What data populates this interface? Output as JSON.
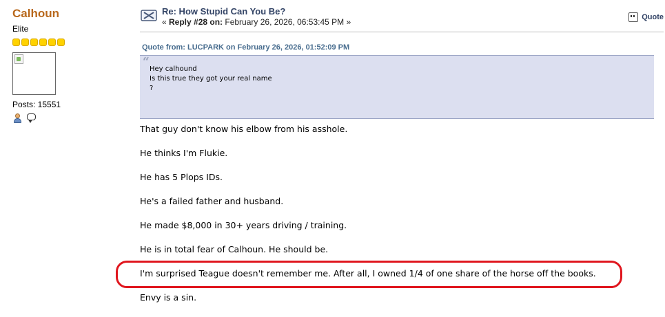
{
  "poster": {
    "name": "Calhoun",
    "rank": "Elite",
    "star_count": 6,
    "posts_label": "Posts: 15551"
  },
  "post": {
    "title": "Re: How Stupid Can You Be?",
    "meta_prefix": "« ",
    "reply_label": "Reply #28 on:",
    "date": " February 26, 2026, 06:53:45 PM »",
    "quote_button": "Quote"
  },
  "quote": {
    "header": "Quote from: LUCPARK on February 26, 2026, 01:52:09 PM",
    "lines": [
      "Hey calhound",
      "Is this true  they got your real  name",
      "?"
    ]
  },
  "body": {
    "paragraphs": [
      "That guy don't know his elbow from his asshole.",
      "He thinks I'm Flukie.",
      "He has 5 Plops IDs.",
      "He's a failed father and husband.",
      "He made $8,000 in 30+ years driving / training.",
      "He is in total fear of Calhoun. He should be.",
      "I'm surprised Teague doesn't remember me. After all, I owned 1/4 of one share of the horse off the books.",
      "Envy is a sin."
    ],
    "highlight_color": "#e0161e"
  }
}
